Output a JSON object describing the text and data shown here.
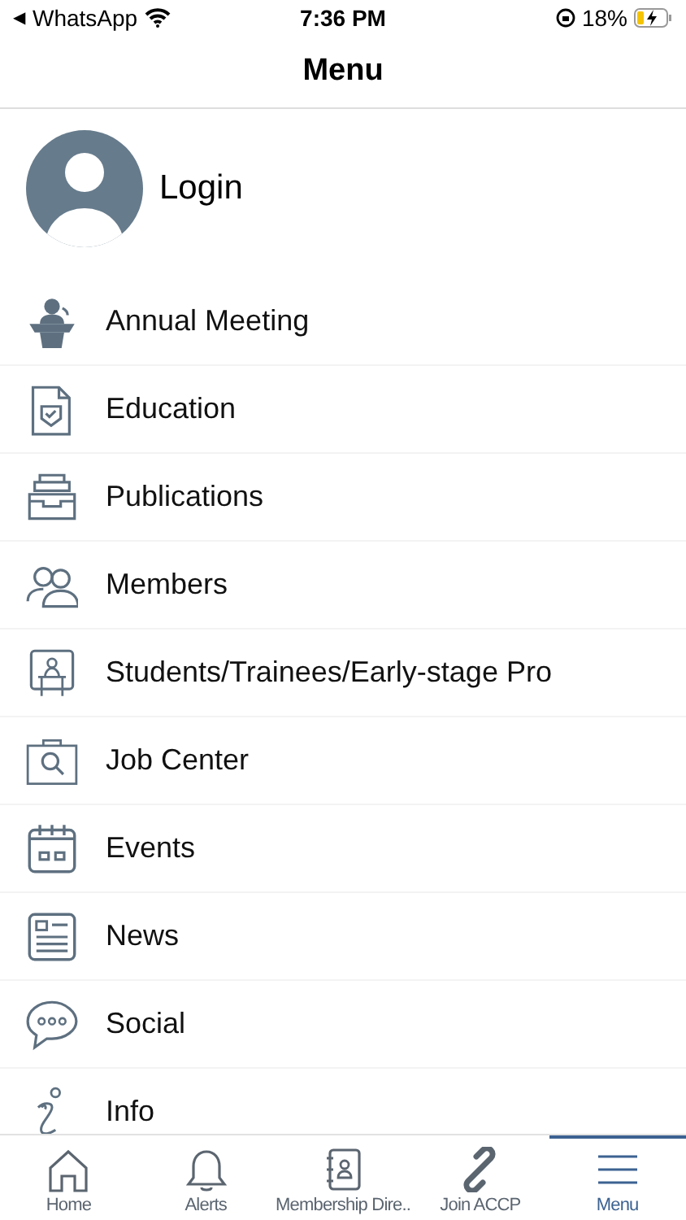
{
  "status_bar": {
    "back_arrow": "◀",
    "back_app": "WhatsApp",
    "time": "7:36 PM",
    "battery": "18%"
  },
  "header": {
    "title": "Menu"
  },
  "login": {
    "label": "Login"
  },
  "menu_items": [
    {
      "kind": "speaker",
      "label": "Annual Meeting"
    },
    {
      "kind": "certificate",
      "label": "Education"
    },
    {
      "kind": "tray",
      "label": "Publications"
    },
    {
      "kind": "people",
      "label": "Members"
    },
    {
      "kind": "desk",
      "label": "Students/Trainees/Early-stage Pro"
    },
    {
      "kind": "jobsearch",
      "label": "Job Center"
    },
    {
      "kind": "calendar",
      "label": "Events"
    },
    {
      "kind": "newspaper",
      "label": "News"
    },
    {
      "kind": "chat",
      "label": "Social"
    },
    {
      "kind": "info",
      "label": "Info"
    }
  ],
  "tabs": [
    {
      "kind": "home",
      "label": "Home",
      "selected": false
    },
    {
      "kind": "bell",
      "label": "Alerts",
      "selected": false
    },
    {
      "kind": "book",
      "label": "Membership Dire..",
      "selected": false
    },
    {
      "kind": "link",
      "label": "Join ACCP",
      "selected": false
    },
    {
      "kind": "menu",
      "label": "Menu",
      "selected": true
    }
  ]
}
